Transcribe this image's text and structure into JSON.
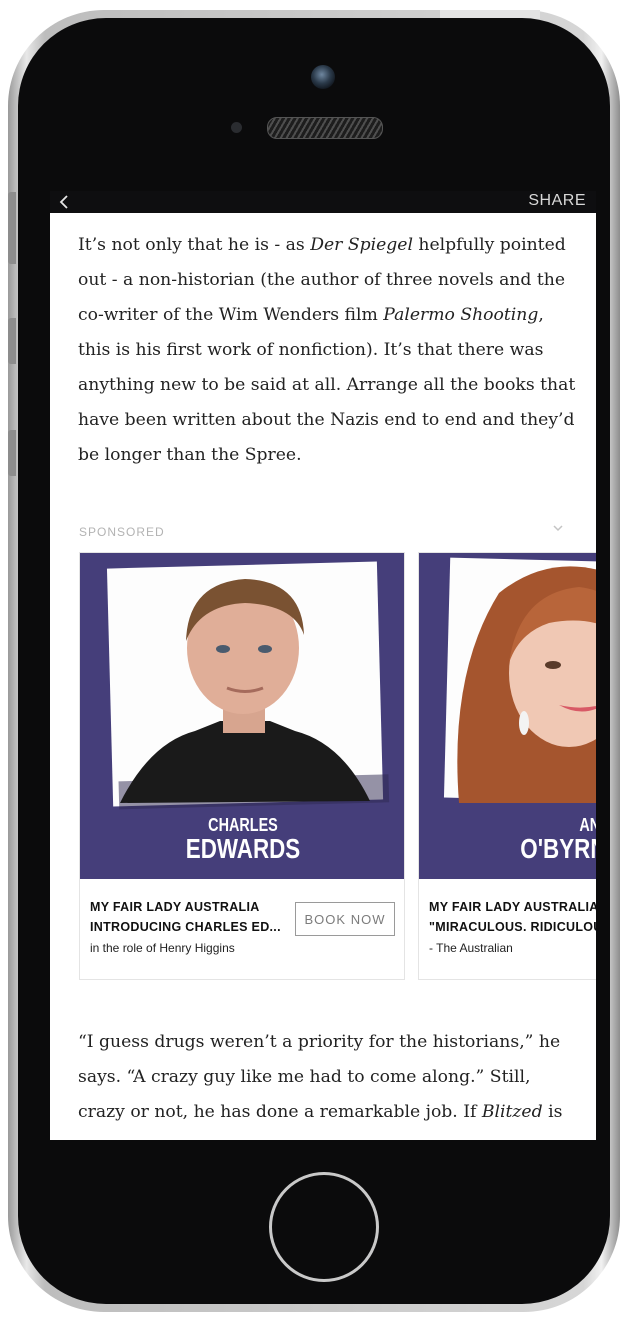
{
  "topbar": {
    "back_icon": "chevron-left-icon",
    "share_label": "SHARE"
  },
  "article": {
    "p1": [
      "It’s not only that he is - as ",
      "Der Spiegel",
      " helpfully pointed out - a non-historian (the author of three novels and the co-writer of the Wim Wenders film ",
      "Palermo Shooting",
      ", this is his first work of nonfiction). It’s that there was anything new to be said at all. Arrange all the books that have been written about the Nazis end to end and they’d be longer than the Spree."
    ],
    "p2": [
      "“I guess drugs weren’t a priority for the historians,” he says. “A crazy guy like me had to come along.” Still, crazy or not, he has done a remarkable job. If ",
      "Blitzed",
      " is"
    ]
  },
  "sponsored": {
    "label": "SPONSORED",
    "collapse_icon": "chevron-down-icon",
    "cards": [
      {
        "first_name": "CHARLES",
        "last_name": "EDWARDS",
        "line1": "MY FAIR LADY AUSTRALIA",
        "line2": "INTRODUCING CHARLES ED...",
        "sub": "in the role of Henry Higgins",
        "button": "BOOK NOW"
      },
      {
        "first_name": "ANNA",
        "last_name": "O'BYRNE",
        "line1": "MY FAIR LADY AUSTRALIA",
        "line2": "\"MIRACULOUS. RIDICULOUS",
        "sub": "- The Australian"
      }
    ]
  },
  "colors": {
    "card_background": "#453e7a",
    "topbar": "#0e0e10",
    "text": "#222222"
  }
}
